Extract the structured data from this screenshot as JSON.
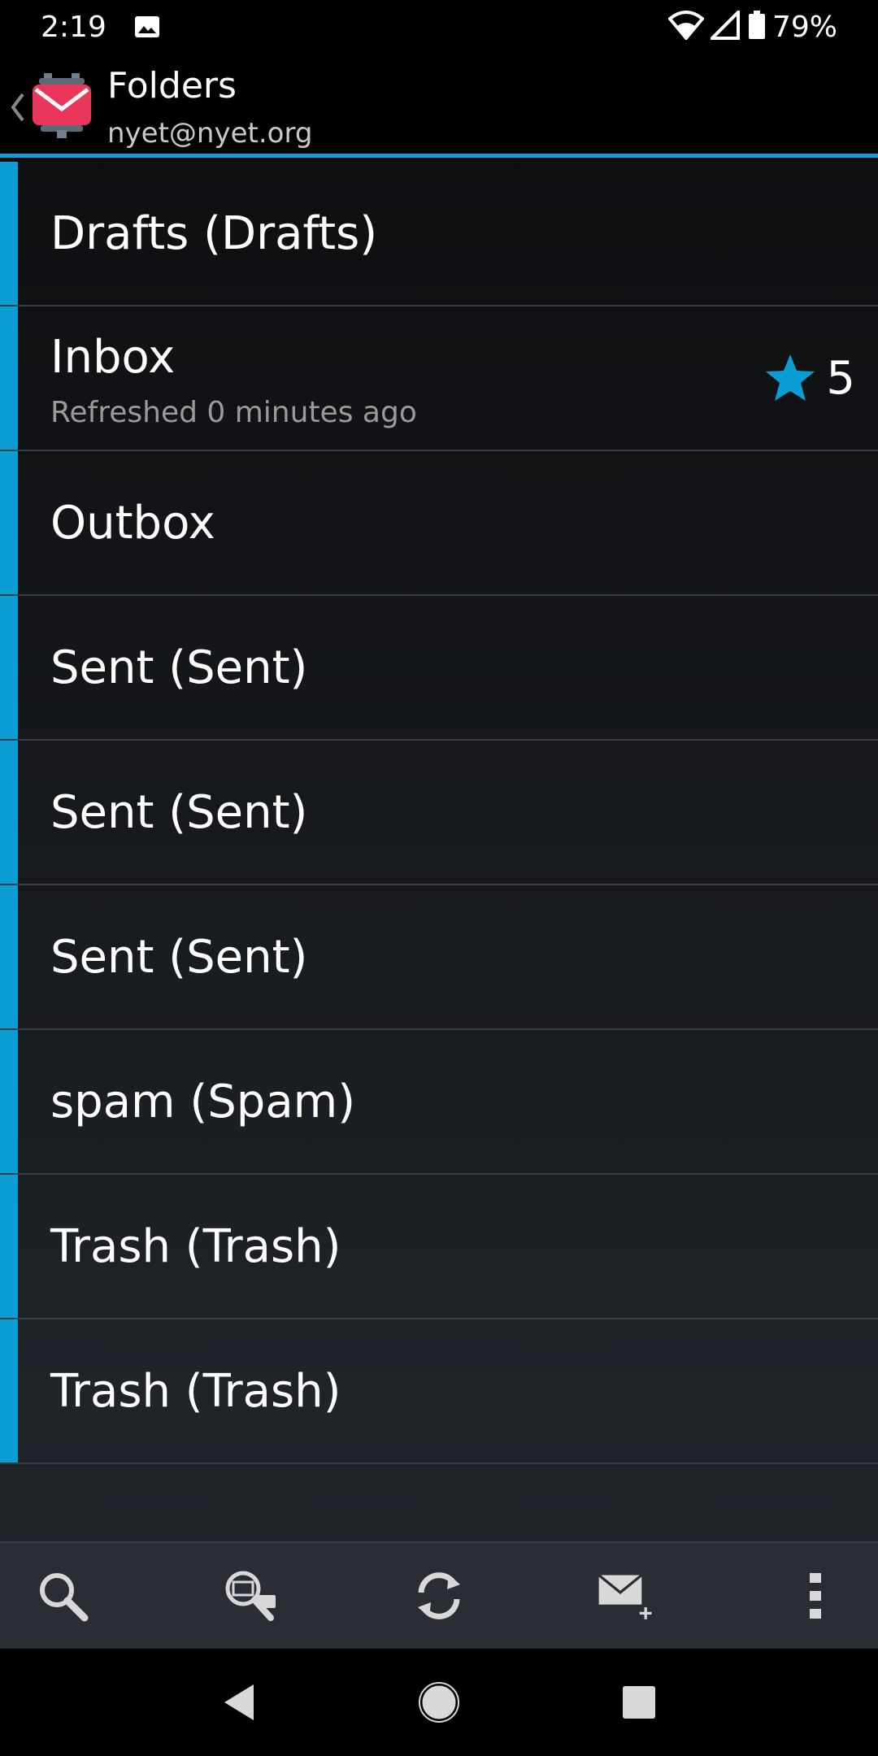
{
  "status_bar": {
    "time": "2:19",
    "battery": "79%"
  },
  "action_bar": {
    "title": "Folders",
    "subtitle": "nyet@nyet.org"
  },
  "folders": [
    {
      "name": "Drafts (Drafts)"
    },
    {
      "name": "Inbox",
      "sub": "Refreshed 0 minutes ago",
      "count": "5"
    },
    {
      "name": "Outbox"
    },
    {
      "name": "Sent (Sent)"
    },
    {
      "name": "Sent (Sent)"
    },
    {
      "name": "Sent (Sent)"
    },
    {
      "name": "spam (Spam)"
    },
    {
      "name": "Trash (Trash)"
    },
    {
      "name": "Trash (Trash)"
    }
  ],
  "colors": {
    "accent": "#0a9ed4",
    "logo": "#e8375a"
  },
  "icons": {
    "toolbar": [
      "search-icon",
      "search-remote-icon",
      "refresh-icon",
      "compose-icon",
      "overflow-menu-icon"
    ],
    "nav": [
      "back-icon",
      "home-icon",
      "recents-icon"
    ]
  }
}
